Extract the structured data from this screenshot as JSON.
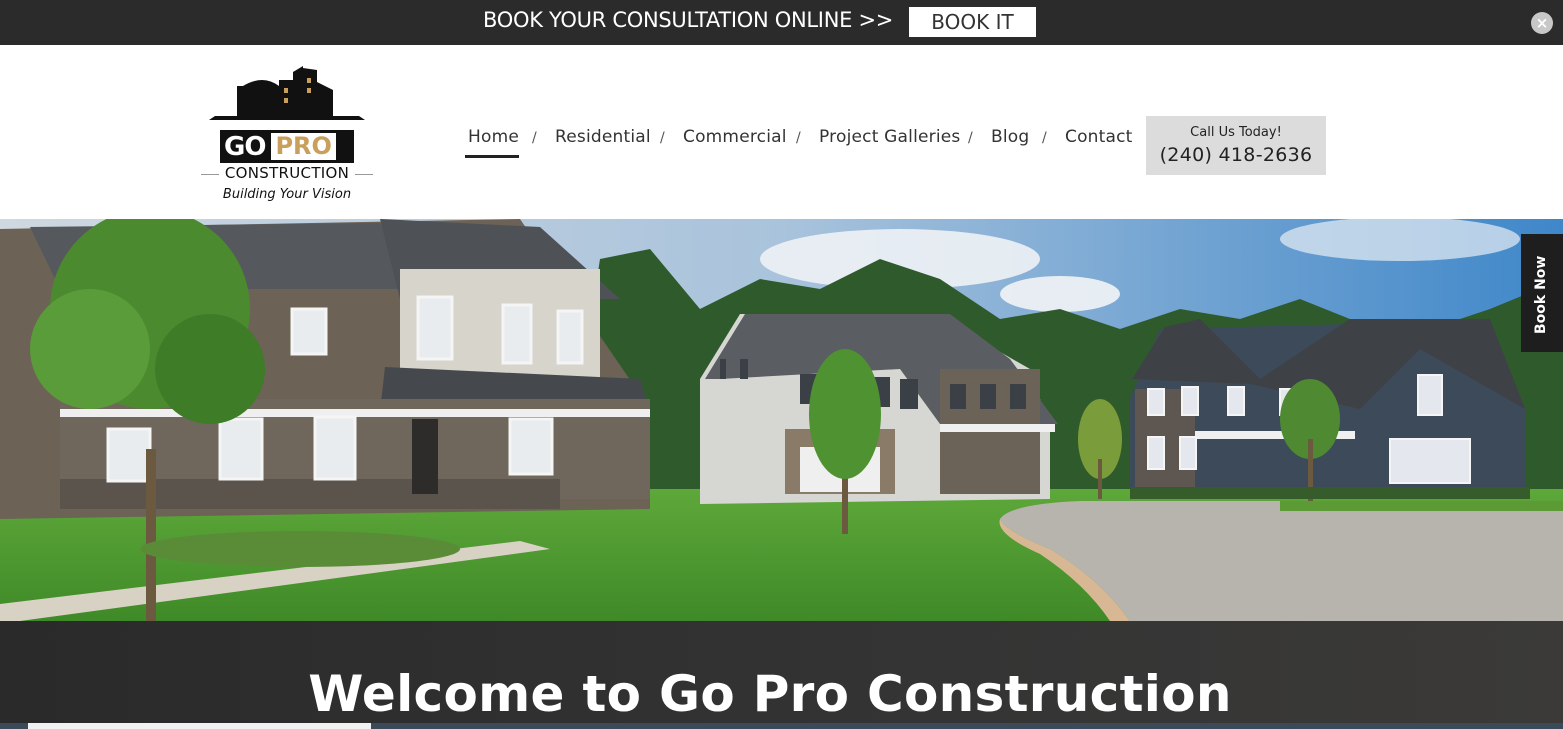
{
  "banner": {
    "text": "BOOK YOUR CONSULTATION ONLINE >>",
    "button_label": "BOOK IT",
    "close_label": "×"
  },
  "logo": {
    "go": "GO",
    "pro": "PRO",
    "sub": "CONSTRUCTION",
    "tagline": "Building Your Vision"
  },
  "nav": {
    "items": [
      {
        "label": "Home",
        "active": true
      },
      {
        "label": "Residential"
      },
      {
        "label": "Commercial"
      },
      {
        "label": "Project Galleries"
      },
      {
        "label": "Blog"
      },
      {
        "label": "Contact"
      }
    ],
    "separator": "/"
  },
  "call": {
    "label": "Call Us Today!",
    "phone": "(240) 418-2636"
  },
  "side_tab": {
    "label": "Book Now"
  },
  "welcome": {
    "title": "Welcome to Go Pro Construction"
  },
  "colors": {
    "accent_gold": "#c9a05b",
    "dark": "#2b2b2b"
  }
}
